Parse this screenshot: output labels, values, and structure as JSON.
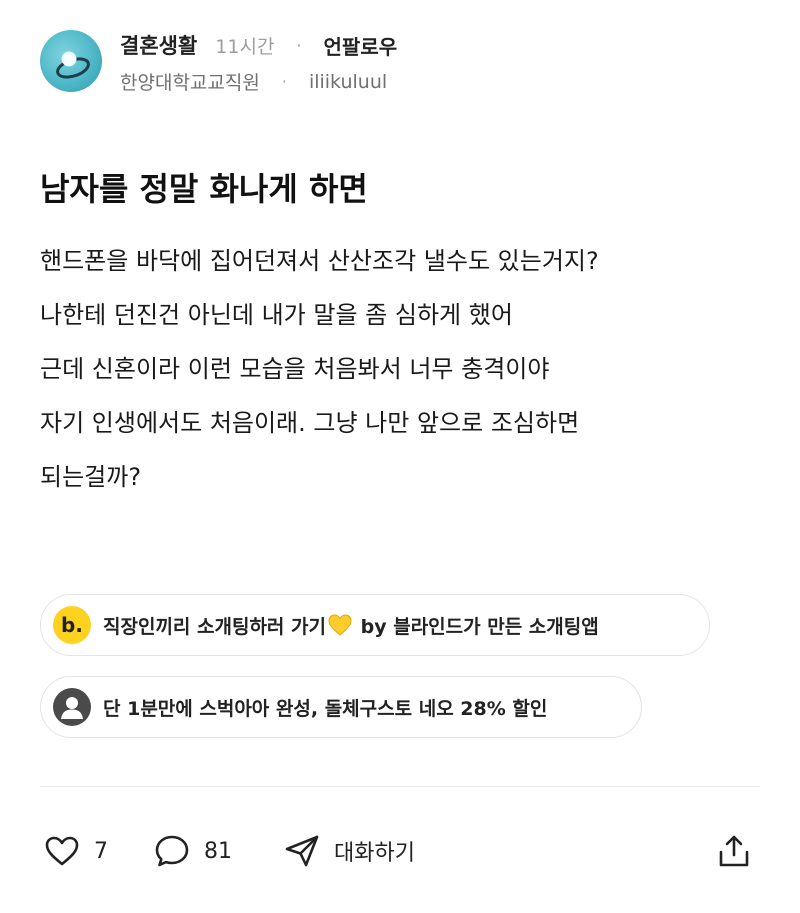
{
  "post": {
    "category": "결혼생활",
    "time": "11시간",
    "tag": "언팔로우",
    "company": "한양대학교교직원",
    "nickname": "iliikuluul",
    "title": "남자를 정말 화나게 하면",
    "body_lines": [
      "핸드폰을 바닥에 집어던져서 산산조각 낼수도 있는거지?",
      "나한테 던진건 아닌데 내가 말을 좀 심하게 했어",
      "근데 신혼이라 이런 모습을 처음봐서 너무 충격이야",
      "자기 인생에서도 처음이래. 그냥 나만 앞으로 조심하면",
      "되는걸까?"
    ]
  },
  "promos": [
    {
      "icon_letter": "b.",
      "text_before": "직장인끼리 소개팅하러 가기",
      "text_after": " by 블라인드가 만든 소개팅앱"
    },
    {
      "text": "단 1분만에 스벅아아 완성, 돌체구스토 네오 28% 할인"
    }
  ],
  "actions": {
    "likes": "7",
    "comments": "81",
    "chat_label": "대화하기"
  },
  "icons": {
    "like": "heart-outline-icon",
    "comment": "speech-bubble-icon",
    "chat": "send-arrow-icon",
    "share": "share-upload-icon",
    "promo_user": "user-circle-icon",
    "promo_heart": "yellow-heart-icon"
  },
  "colors": {
    "brand_yellow": "#ffd21f",
    "text_primary": "#111111",
    "text_secondary": "#707070",
    "border": "#e4e4e4"
  }
}
